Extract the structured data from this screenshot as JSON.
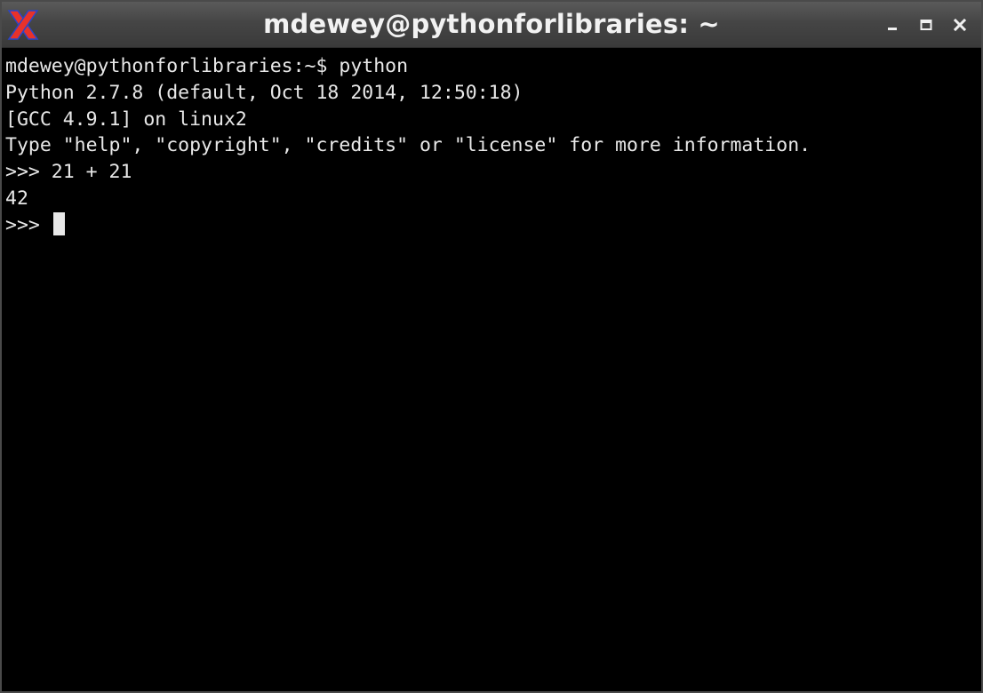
{
  "window": {
    "title": "mdewey@pythonforlibraries: ~",
    "app_icon": "x-logo-icon",
    "controls": [
      "minimize-icon",
      "maximize-icon",
      "close-icon"
    ]
  },
  "terminal": {
    "lines": [
      "mdewey@pythonforlibraries:~$ python",
      "Python 2.7.8 (default, Oct 18 2014, 12:50:18)",
      "[GCC 4.9.1] on linux2",
      "Type \"help\", \"copyright\", \"credits\" or \"license\" for more information.",
      ">>> 21 + 21",
      "42"
    ],
    "prompt": ">>> "
  },
  "colors": {
    "background": "#000000",
    "foreground": "#e8e8e8",
    "titlebar": "#454545",
    "title_text": "#f2f2f2",
    "icon_red": "#e8322a",
    "icon_blue": "#2a45c8"
  }
}
